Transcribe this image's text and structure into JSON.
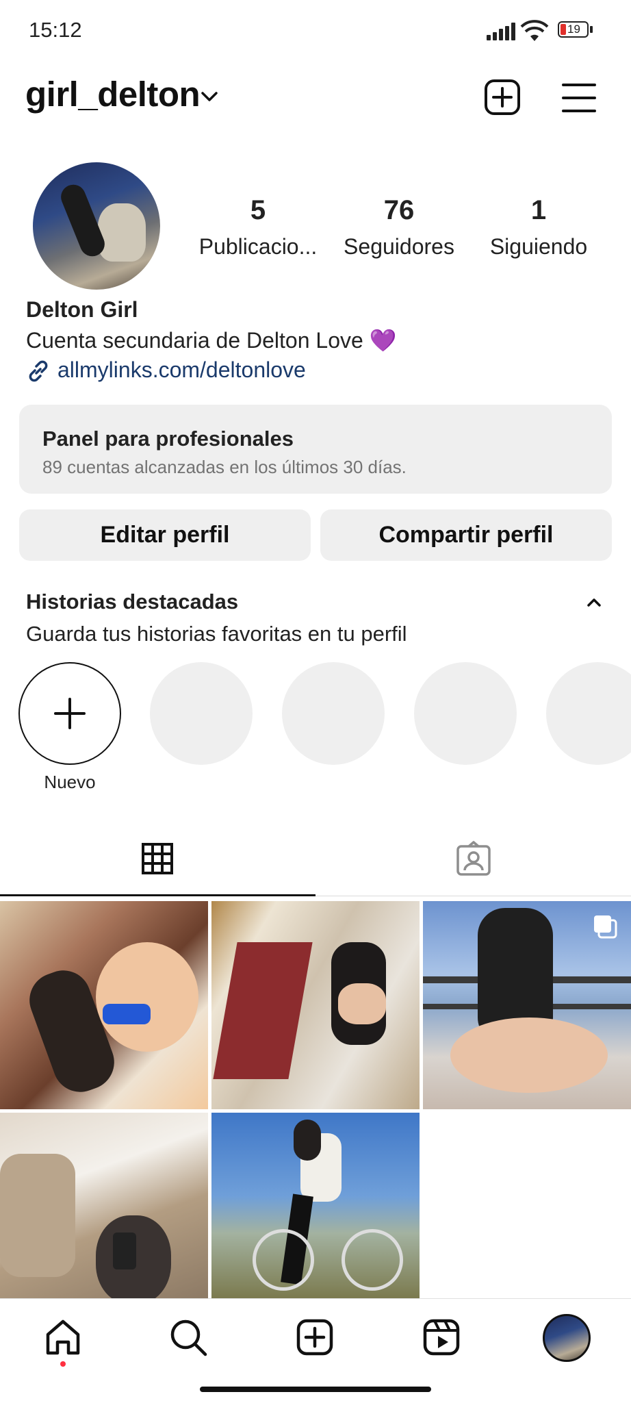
{
  "status_bar": {
    "time": "15:12",
    "battery_level": "19",
    "icons": [
      "signal-icon",
      "wifi-icon",
      "battery-icon"
    ]
  },
  "header": {
    "username": "girl_delton",
    "icons": [
      "chevron-down-icon",
      "new-post-icon",
      "menu-icon"
    ]
  },
  "profile": {
    "stats": [
      {
        "value": "5",
        "label": "Publicacio..."
      },
      {
        "value": "76",
        "label": "Seguidores"
      },
      {
        "value": "1",
        "label": "Siguiendo"
      }
    ],
    "display_name": "Delton Girl",
    "bio": "Cuenta secundaria de Delton Love 💜",
    "link": "allmylinks.com/deltonlove"
  },
  "pro_panel": {
    "title": "Panel para profesionales",
    "subtitle": "89 cuentas alcanzadas en los últimos 30 días."
  },
  "buttons": {
    "edit": "Editar perfil",
    "share": "Compartir perfil"
  },
  "highlights": {
    "title": "Historias destacadas",
    "subtitle": "Guarda tus historias favoritas en tu perfil",
    "new_label": "Nuevo"
  },
  "tabs": [
    "grid-icon",
    "tagged-icon"
  ],
  "bottom_nav": [
    "home-icon",
    "search-icon",
    "create-icon",
    "reels-icon",
    "profile-avatar"
  ],
  "colors": {
    "text": "#111111",
    "muted": "#737373",
    "panel_bg": "#efefef",
    "link": "#1a3a6b",
    "notification_dot": "#ff3040",
    "battery_low": "#e0302b"
  }
}
